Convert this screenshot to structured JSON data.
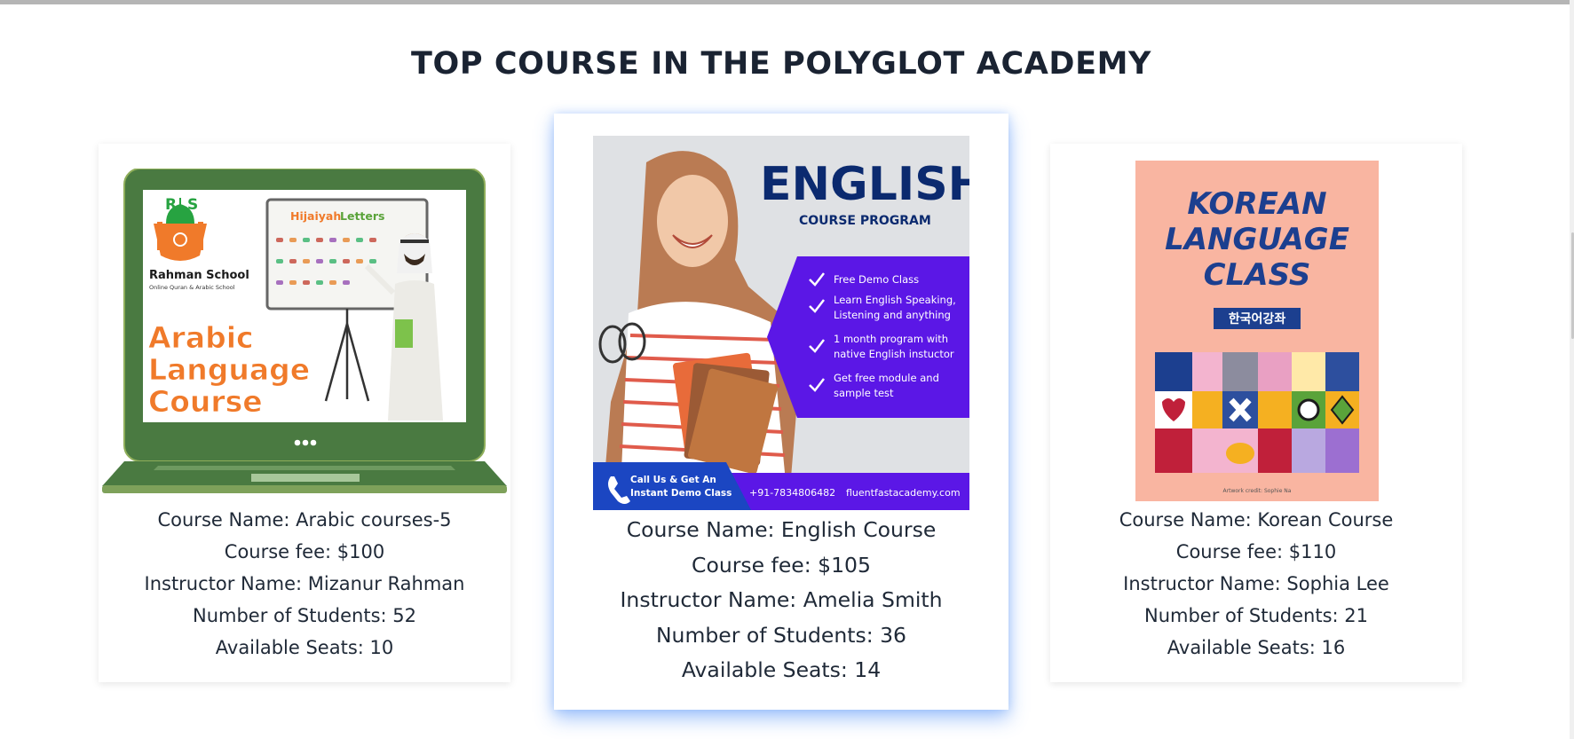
{
  "section": {
    "title": "TOP COURSE IN THE POLYGLOT ACADEMY"
  },
  "courses": [
    {
      "name": "Course Name: Arabic courses-5",
      "fee": "Course fee: $100",
      "instructor": "Instructor Name: Mizanur Rahman",
      "students": "Number of Students: 52",
      "seats": "Available Seats: 10",
      "poster": {
        "school": "Rahman School",
        "tagline": "Online Quran & Arabic School",
        "board_title_1": "Hijaiyah",
        "board_title_2": "Letters",
        "line1": "Arabic",
        "line2": "Language",
        "line3": "Course",
        "logo_letter_left": "R",
        "logo_letter_right": "S"
      }
    },
    {
      "name": "Course Name: English Course",
      "fee": "Course fee: $105",
      "instructor": "Instructor Name: Amelia Smith",
      "students": "Number of Students: 36",
      "seats": "Available Seats: 14",
      "poster": {
        "headline": "ENGLISH",
        "subhead": "COURSE PROGRAM",
        "features": [
          [
            "Free Demo Class"
          ],
          [
            "Learn English Speaking,",
            "Listening and anything"
          ],
          [
            "1 month program with",
            "native English instuctor"
          ],
          [
            "Get free module and",
            "sample test"
          ]
        ],
        "cta_1": "Call Us & Get An",
        "cta_2": "Instant Demo Class",
        "phone": "+91-7834806482",
        "website": "fluentfastacademy.com"
      }
    },
    {
      "name": "Course Name: Korean Course",
      "fee": "Course fee: $110",
      "instructor": "Instructor Name: Sophia Lee",
      "students": "Number of Students: 21",
      "seats": "Available Seats: 16",
      "poster": {
        "line1": "KOREAN",
        "line2": "LANGUAGE",
        "line3": "CLASS",
        "hangul": "한국어강좌",
        "credit": "Artwork credit: Sophie Na"
      }
    }
  ],
  "colors": {
    "title": "#1a2332",
    "laptop_green": "#4a7a41",
    "arabic_orange": "#f07a2a",
    "english_navy": "#0b2a6f",
    "english_purple": "#5b17e6",
    "korean_peach": "#f9b5a1",
    "korean_navy": "#1c3f8f",
    "featured_glow": "#3b82f6"
  },
  "icons": [
    "check-icon",
    "phone-icon",
    "mosque-logo-icon",
    "laptop-dots-icon"
  ]
}
